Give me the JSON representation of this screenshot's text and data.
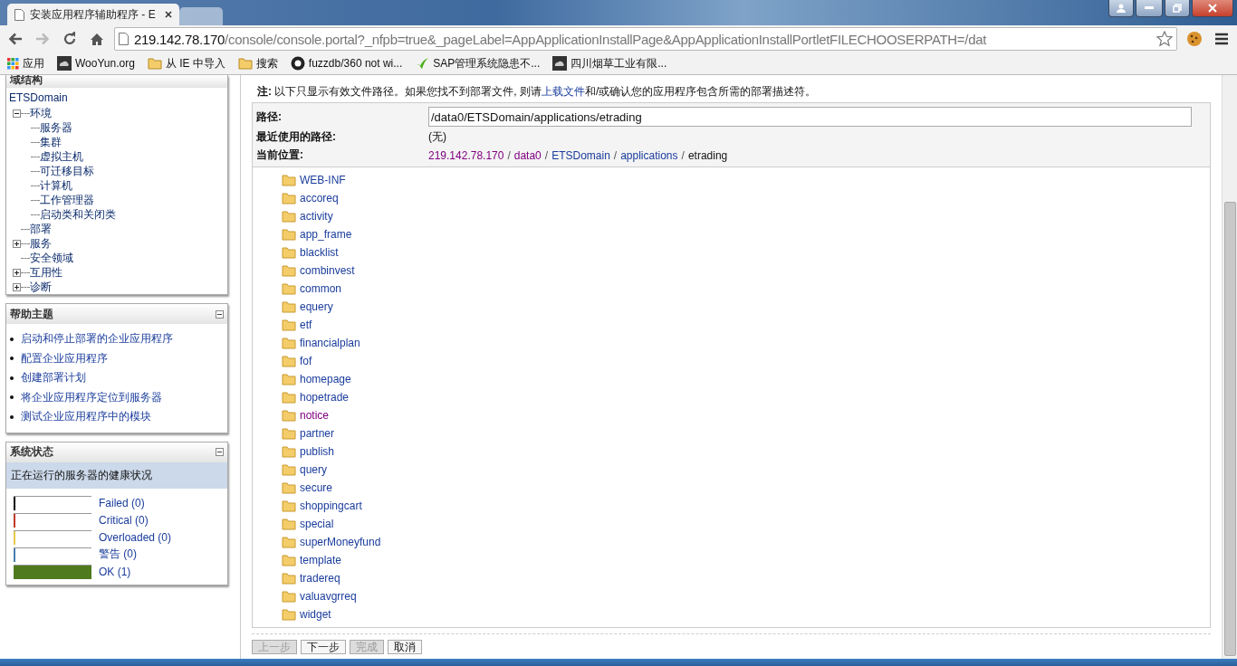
{
  "browser": {
    "tabs": [
      {
        "title": "安装应用程序辅助程序 - E",
        "selected": true
      },
      {
        "selected": false
      }
    ],
    "url": {
      "host": "219.142.78.170",
      "path": "/console/console.portal?_nfpb=true&_pageLabel=AppApplicationInstallPage&AppApplicationInstallPortletFILECHOOSERPATH=/dat"
    },
    "bookmarks": [
      {
        "kind": "apps",
        "label": "应用"
      },
      {
        "kind": "site",
        "label": "WooYun.org"
      },
      {
        "kind": "folder",
        "label": "从 IE 中导入"
      },
      {
        "kind": "folder",
        "label": "搜索"
      },
      {
        "kind": "github",
        "label": "fuzzdb/360 not wi..."
      },
      {
        "kind": "leaf",
        "label": "SAP管理系统隐患不..."
      },
      {
        "kind": "site",
        "label": "四川烟草工业有限..."
      }
    ]
  },
  "domain_tree": {
    "title": "域结构",
    "root": "ETSDomain",
    "items": [
      {
        "label": "环境",
        "expanded": true,
        "children": [
          {
            "label": "服务器"
          },
          {
            "label": "集群"
          },
          {
            "label": "虚拟主机"
          },
          {
            "label": "可迁移目标"
          },
          {
            "label": "计算机"
          },
          {
            "label": "工作管理器"
          },
          {
            "label": "启动类和关闭类"
          }
        ]
      },
      {
        "label": "部署"
      },
      {
        "label": "服务",
        "expanded": false
      },
      {
        "label": "安全领域"
      },
      {
        "label": "互用性",
        "expanded": false
      },
      {
        "label": "诊断",
        "expanded": false
      }
    ]
  },
  "help_topics": {
    "title": "帮助主题",
    "items": [
      "启动和停止部署的企业应用程序",
      "配置企业应用程序",
      "创建部署计划",
      "将企业应用程序定位到服务器",
      "测试企业应用程序中的模块"
    ]
  },
  "system_status": {
    "title": "系统状态",
    "subtitle": "正在运行的服务器的健康状况",
    "items": [
      {
        "label": "Failed (0)",
        "color": "#000000",
        "level": 0
      },
      {
        "label": "Critical (0)",
        "color": "#c0392b",
        "level": 0
      },
      {
        "label": "Overloaded (0)",
        "color": "#e8c84a",
        "level": 0
      },
      {
        "label": "警告 (0)",
        "color": "#4a7fb0",
        "level": 0
      },
      {
        "label": "OK (1)",
        "color": "#4f7a1e",
        "level": 1
      }
    ]
  },
  "note": {
    "prefix": "注:",
    "text": "以下只显示有效文件路径。如果您找不到部署文件, 则请",
    "link": "上载文件",
    "suffix": "和/或确认您的应用程序包含所需的部署描述符。"
  },
  "path": {
    "label": "路径:",
    "value": "/data0/ETSDomain/applications/etrading"
  },
  "recent": {
    "label": "最近使用的路径:",
    "value": "(无)"
  },
  "location": {
    "label": "当前位置:",
    "crumbs": [
      {
        "kind": "link",
        "label": "219.142.78.170",
        "visited": true
      },
      {
        "kind": "separator",
        "label": "/"
      },
      {
        "kind": "link",
        "label": "data0",
        "visited": true
      },
      {
        "kind": "separator",
        "label": "/"
      },
      {
        "kind": "link",
        "label": "ETSDomain",
        "visited": false
      },
      {
        "kind": "separator",
        "label": "/"
      },
      {
        "kind": "link",
        "label": "applications",
        "visited": false
      },
      {
        "kind": "separator",
        "label": "/"
      },
      {
        "kind": "current",
        "label": "etrading"
      }
    ]
  },
  "folders": [
    {
      "name": "WEB-INF",
      "visited": false
    },
    {
      "name": "accoreq",
      "visited": false
    },
    {
      "name": "activity",
      "visited": false
    },
    {
      "name": "app_frame",
      "visited": false
    },
    {
      "name": "blacklist",
      "visited": false
    },
    {
      "name": "combinvest",
      "visited": false
    },
    {
      "name": "common",
      "visited": false
    },
    {
      "name": "equery",
      "visited": false
    },
    {
      "name": "etf",
      "visited": false
    },
    {
      "name": "financialplan",
      "visited": false
    },
    {
      "name": "fof",
      "visited": false
    },
    {
      "name": "homepage",
      "visited": false
    },
    {
      "name": "hopetrade",
      "visited": false
    },
    {
      "name": "notice",
      "visited": true
    },
    {
      "name": "partner",
      "visited": false
    },
    {
      "name": "publish",
      "visited": false
    },
    {
      "name": "query",
      "visited": false
    },
    {
      "name": "secure",
      "visited": false
    },
    {
      "name": "shoppingcart",
      "visited": false
    },
    {
      "name": "special",
      "visited": false
    },
    {
      "name": "superMoneyfund",
      "visited": false
    },
    {
      "name": "template",
      "visited": false
    },
    {
      "name": "tradereq",
      "visited": false
    },
    {
      "name": "valuavgrreq",
      "visited": false
    },
    {
      "name": "widget",
      "visited": false
    }
  ],
  "buttons": [
    {
      "label": "上一步",
      "disabled": true
    },
    {
      "label": "下一步",
      "disabled": false
    },
    {
      "label": "完成",
      "disabled": true
    },
    {
      "label": "取消",
      "disabled": false
    }
  ]
}
